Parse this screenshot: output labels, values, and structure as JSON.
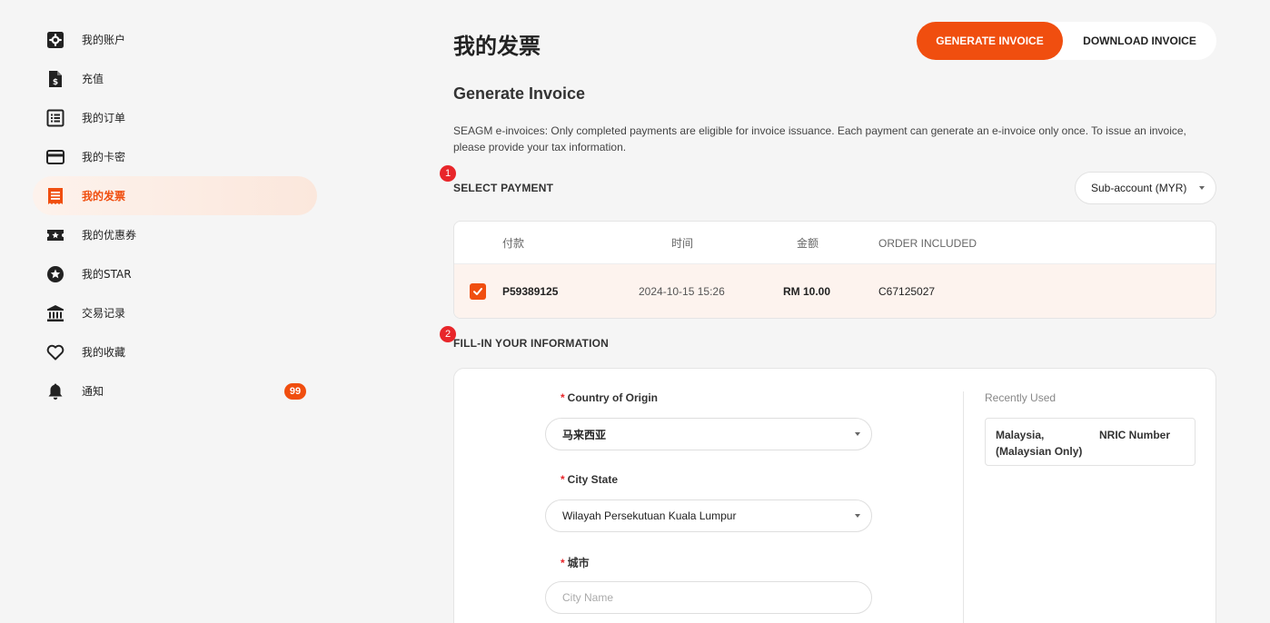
{
  "sidebar": {
    "items": [
      {
        "label": "我的账户",
        "icon": "gear-icon"
      },
      {
        "label": "充值",
        "icon": "topup-document-icon"
      },
      {
        "label": "我的订单",
        "icon": "orders-list-icon"
      },
      {
        "label": "我的卡密",
        "icon": "card-icon"
      },
      {
        "label": "我的发票",
        "icon": "invoice-icon",
        "active": true
      },
      {
        "label": "我的优惠券",
        "icon": "coupon-icon"
      },
      {
        "label": "我的STAR",
        "icon": "star-icon"
      },
      {
        "label": "交易记录",
        "icon": "bank-icon"
      },
      {
        "label": "我的收藏",
        "icon": "heart-icon"
      },
      {
        "label": "通知",
        "icon": "bell-icon",
        "badge": "99"
      }
    ]
  },
  "header": {
    "title": "我的发票",
    "generate_label": "GENERATE INVOICE",
    "download_label": "DOWNLOAD INVOICE"
  },
  "section": {
    "title": "Generate Invoice",
    "description": "SEAGM e-invoices: Only completed payments are eligible for invoice issuance. Each payment can generate an e-invoice only once. To issue an invoice, please provide your tax information."
  },
  "step1": {
    "number": "1",
    "label": "SELECT PAYMENT",
    "account_select": "Sub-account (MYR)"
  },
  "table": {
    "headers": [
      "付款",
      "时间",
      "金额",
      "ORDER INCLUDED"
    ],
    "rows": [
      {
        "payment": "P59389125",
        "time": "2024-10-15 15:26",
        "amount": "RM 10.00",
        "order": "C67125027",
        "checked": true
      }
    ]
  },
  "step2": {
    "number": "2",
    "label": "FILL-IN YOUR INFORMATION"
  },
  "form": {
    "required_mark": "*",
    "country_label": "Country of Origin",
    "country_value": "马来西亚",
    "state_label": "City State",
    "state_value": "Wilayah Persekutuan Kuala Lumpur",
    "city_label": "城市",
    "city_placeholder": "City Name",
    "recent_title": "Recently Used",
    "recent_country": "Malaysia, (Malaysian Only)",
    "recent_id_type": "NRIC Number"
  },
  "colors": {
    "accent": "#f04e0f",
    "step_badge": "#e8262a"
  }
}
